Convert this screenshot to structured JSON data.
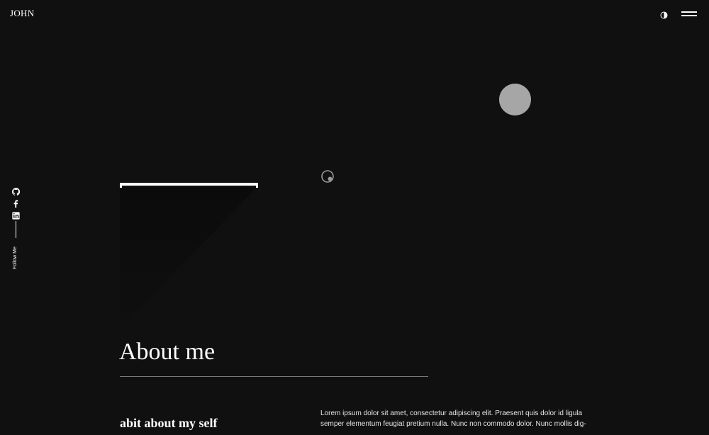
{
  "header": {
    "logo": "JOHN",
    "theme_toggle_icon": "half-circle-icon",
    "menu_icon": "hamburger-menu-icon"
  },
  "social": {
    "icons": [
      "github-icon",
      "facebook-icon",
      "linkedin-icon"
    ],
    "follow_label": "Follow Me"
  },
  "about": {
    "title": "About me",
    "subtitle": "abit about my self",
    "body": "Lorem ipsum dolor sit amet, consectetur adipiscing elit. Praesent quis dolor id ligula semper elementum feugiat pretium nulla. Nunc non commodo dolor. Nunc mollis dig-"
  },
  "colors": {
    "background": "#101010",
    "text": "#ffffff",
    "circle": "#a6a6a6",
    "rule": "#7a7a7a"
  }
}
